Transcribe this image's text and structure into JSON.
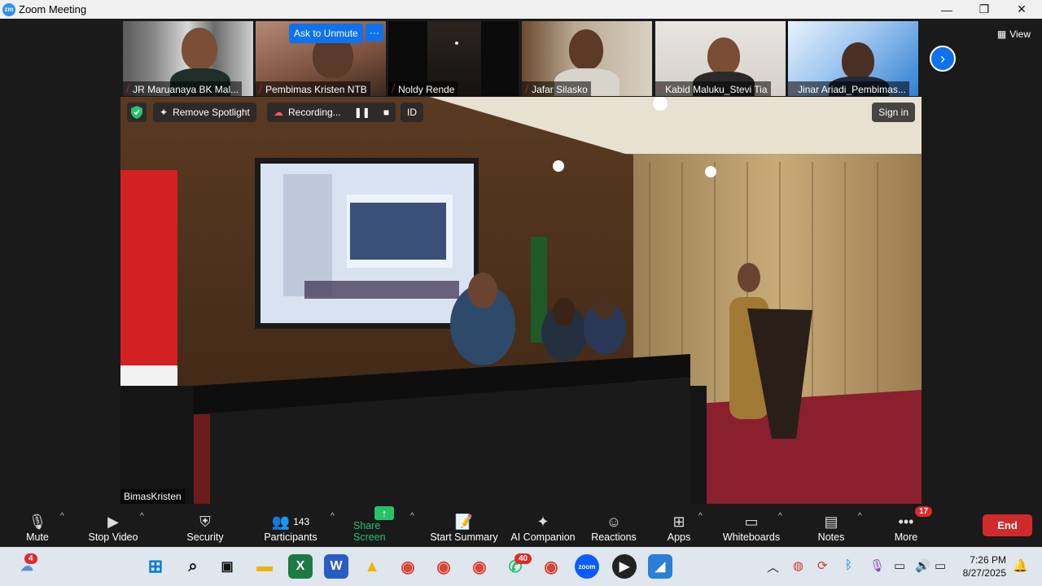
{
  "window": {
    "title": "Zoom Meeting",
    "minimize": "—",
    "maximize": "❐",
    "close": "✕"
  },
  "gallery": {
    "participants": [
      {
        "name": "JR Maruanaya BK Mal..."
      },
      {
        "name": "Pembimas Kristen NTB"
      },
      {
        "name": "Noldy Rende"
      },
      {
        "name": "Jafar Silasko"
      },
      {
        "name": "Kabid Maluku_Stevi Tia"
      },
      {
        "name": "Jinar Ariadi_Pembimas..."
      }
    ],
    "ask_to_unmute": "Ask to Unmute",
    "more_dots": "···",
    "view_label": "View",
    "next_arrow": "›"
  },
  "main": {
    "remove_spotlight": "Remove Spotlight",
    "recording": "Recording...",
    "id_label": "ID",
    "sign_in": "Sign in",
    "speaker_name": "BimasKristen"
  },
  "toolbar": {
    "mute": "Mute",
    "stop_video": "Stop Video",
    "security": "Security",
    "participants": "Participants",
    "participants_count": "143",
    "share_screen": "Share Screen",
    "start_summary": "Start Summary",
    "ai_companion": "AI Companion",
    "reactions": "Reactions",
    "apps": "Apps",
    "whiteboards": "Whiteboards",
    "notes": "Notes",
    "more": "More",
    "more_badge": "17",
    "end": "End",
    "caret": "^"
  },
  "taskbar": {
    "weather_badge": "4",
    "whatsapp_badge": "40",
    "zoom_label": "zoom",
    "time": "7:26 PM",
    "date": "8/27/2025"
  },
  "colors": {
    "accent": "#0e72ed",
    "end": "#d12a2a",
    "share": "#25c26b"
  }
}
